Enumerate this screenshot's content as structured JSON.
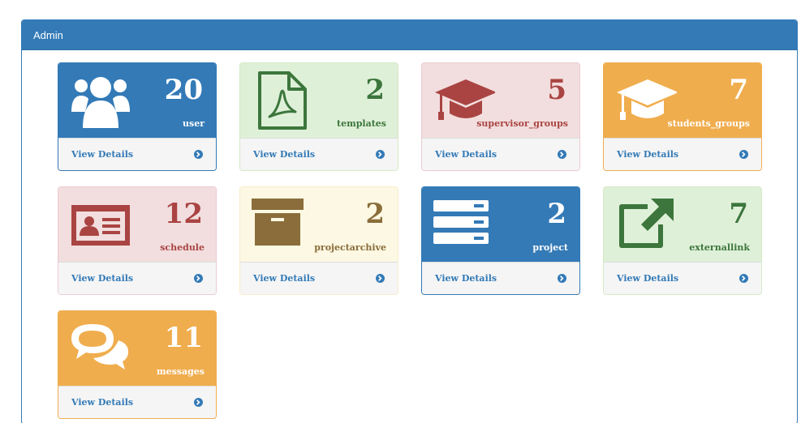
{
  "panel": {
    "title": "Admin"
  },
  "cards": [
    {
      "count": "20",
      "label": "user",
      "footer": "View Details",
      "icon": "users-icon",
      "style": "primary"
    },
    {
      "count": "2",
      "label": "templates",
      "footer": "View Details",
      "icon": "pdf-file-icon",
      "style": "success"
    },
    {
      "count": "5",
      "label": "supervisor_groups",
      "footer": "View Details",
      "icon": "graduation-cap-icon",
      "style": "danger"
    },
    {
      "count": "7",
      "label": "students_groups",
      "footer": "View Details",
      "icon": "graduation-cap-icon",
      "style": "warning-solid"
    },
    {
      "count": "12",
      "label": "schedule",
      "footer": "View Details",
      "icon": "id-card-icon",
      "style": "danger"
    },
    {
      "count": "2",
      "label": "projectarchive",
      "footer": "View Details",
      "icon": "archive-box-icon",
      "style": "warning-light"
    },
    {
      "count": "2",
      "label": "project",
      "footer": "View Details",
      "icon": "server-icon",
      "style": "primary"
    },
    {
      "count": "7",
      "label": "externallink",
      "footer": "View Details",
      "icon": "external-link-icon",
      "style": "success"
    },
    {
      "count": "11",
      "label": "messages",
      "footer": "View Details",
      "icon": "chat-bubbles-icon",
      "style": "warning-solid"
    }
  ]
}
